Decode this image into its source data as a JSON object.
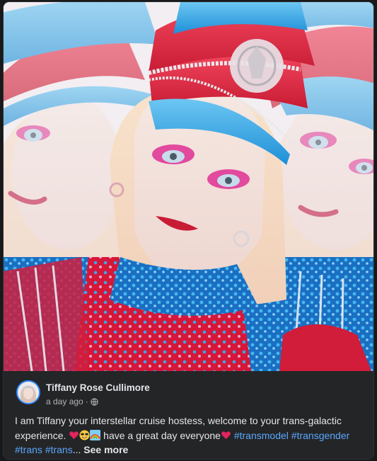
{
  "post": {
    "image_alt": "Triple-exposure portrait of Tiffany wearing a red and blue sequined captain hat and costume",
    "author": "Tiffany Rose Cullimore",
    "time": "a day ago",
    "separator": "·",
    "privacy_icon": "globe-icon",
    "caption_text": "I am Tiffany your interstellar cruise hostess, welcome to your trans-galactic experience.",
    "caption_mid": "have a great day everyone",
    "emojis": [
      "red-heart-emoji",
      "grinning-sunglasses-emoji",
      "rainbow-emoji"
    ],
    "hashtags": [
      "#transmodel",
      "#transgender",
      "#trans",
      "#trans"
    ],
    "truncation": "...",
    "see_more": "See more"
  },
  "colors": {
    "card_bg": "#242526",
    "page_bg": "#18191a",
    "text_primary": "#e4e6eb",
    "text_secondary": "#b0b3b8",
    "link": "#5aa7ff",
    "avatar_ring": "#2d88ff"
  }
}
